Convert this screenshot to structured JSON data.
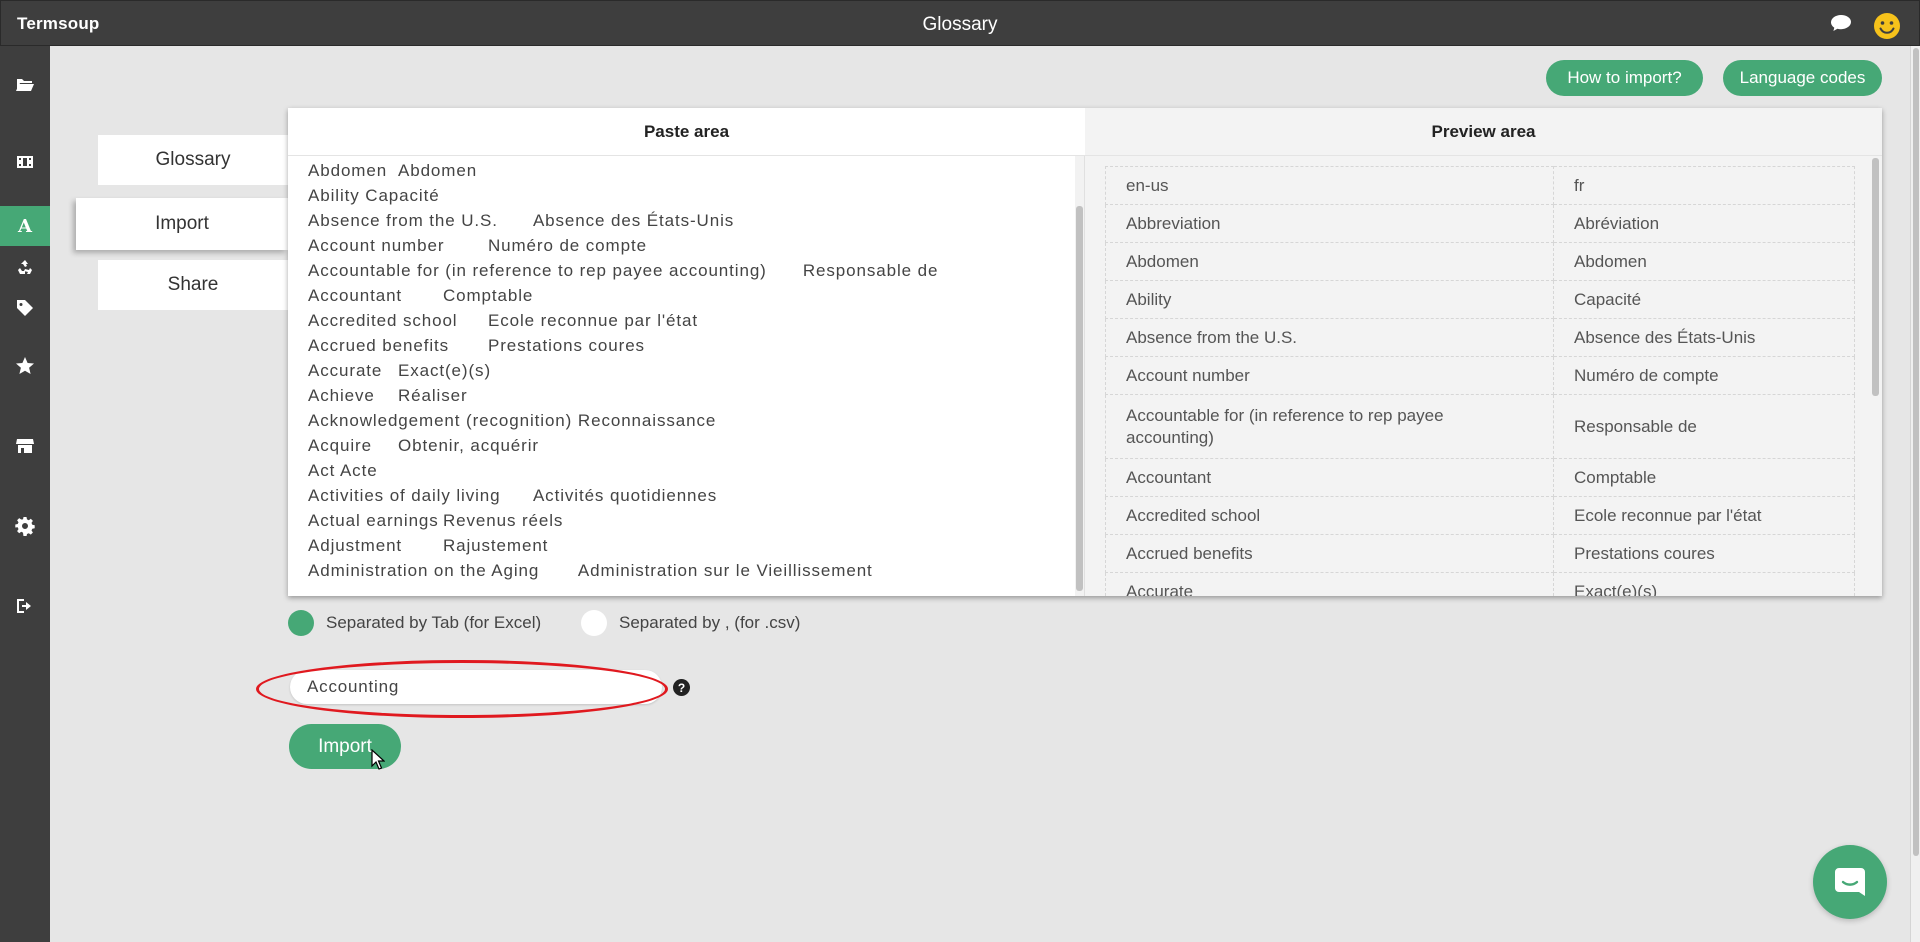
{
  "app": {
    "brand": "Termsoup",
    "title": "Glossary"
  },
  "header": {
    "buttons": {
      "how_to_import": "How to import?",
      "language_codes": "Language codes"
    }
  },
  "tabs": {
    "glossary": "Glossary",
    "import": "Import",
    "share": "Share"
  },
  "sidebar": {
    "items": [
      {
        "icon": "folder-open-icon"
      },
      {
        "icon": "film-icon"
      },
      {
        "icon": "glossary-letter-icon",
        "label": "A",
        "active": true
      },
      {
        "icon": "recycle-icon"
      },
      {
        "icon": "tag-icon"
      },
      {
        "icon": "star-icon"
      },
      {
        "icon": "store-icon"
      },
      {
        "icon": "gear-icon"
      },
      {
        "icon": "sign-out-icon"
      }
    ]
  },
  "paste_area": {
    "title": "Paste area",
    "lines": [
      "Abdomen\tAbdomen",
      "Ability Capacité",
      "Absence from the U.S.\tAbsence des États-Unis",
      "Account number\tNuméro de compte",
      "Accountable for (in reference to rep payee accounting)\tResponsable de",
      "Accountant\tComptable",
      "Accredited school\tEcole reconnue par l'état",
      "Accrued benefits\tPrestations coures",
      "Accurate\tExact(e)(s)",
      "Achieve\tRéaliser",
      "Acknowledgement (recognition)\tReconnaissance",
      "Acquire\tObtenir, acquérir",
      "Act Acte",
      "Activities of daily living\tActivités quotidiennes",
      "Actual earnings\tRevenus réels",
      "Adjustment\tRajustement",
      "Administration on the Aging\tAdministration sur le Vieillissement"
    ]
  },
  "preview_area": {
    "title": "Preview area",
    "rows": [
      [
        "en-us",
        "fr"
      ],
      [
        "Abbreviation",
        "Abréviation"
      ],
      [
        "Abdomen",
        "Abdomen"
      ],
      [
        "Ability",
        "Capacité"
      ],
      [
        "Absence from the U.S.",
        "Absence des États-Unis"
      ],
      [
        "Account number",
        "Numéro de compte"
      ],
      [
        "Accountable for (in reference to rep payee accounting)",
        "Responsable de"
      ],
      [
        "Accountant",
        "Comptable"
      ],
      [
        "Accredited school",
        "Ecole reconnue par l'état"
      ],
      [
        "Accrued benefits",
        "Prestations coures"
      ],
      [
        "Accurate",
        "Exact(e)(s)"
      ]
    ]
  },
  "options": {
    "separator_tab": "Separated by Tab (for Excel)",
    "separator_csv": "Separated by , (for .csv)",
    "selected": "tab"
  },
  "glossary_name": {
    "value": "Accounting"
  },
  "import_button": "Import",
  "colors": {
    "accent": "#46a876",
    "dark": "#3e3e3e",
    "highlight": "#e0191f"
  }
}
